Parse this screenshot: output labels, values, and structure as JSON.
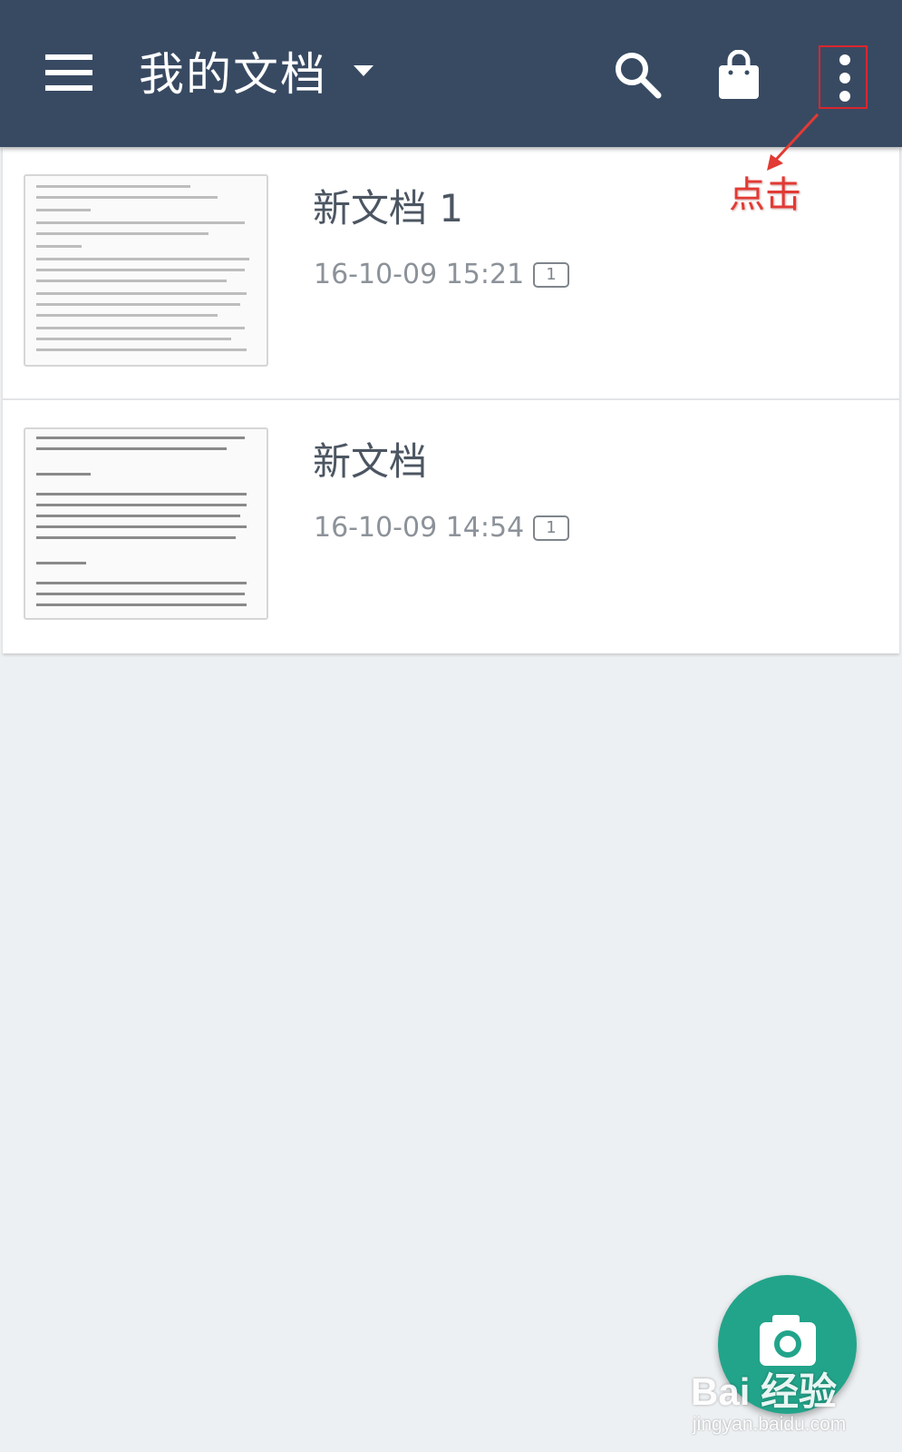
{
  "header": {
    "title": "我的文档",
    "background_color": "#384a62",
    "icons": [
      "menu-icon",
      "dropdown-caret-icon",
      "search-icon",
      "shopping-bag-icon",
      "more-vert-icon"
    ]
  },
  "documents": [
    {
      "name": "新文档 1",
      "timestamp": "16-10-09 15:21",
      "page_count": "1"
    },
    {
      "name": "新文档",
      "timestamp": "16-10-09 14:54",
      "page_count": "1"
    }
  ],
  "annotation": {
    "text": "点击",
    "color": "#e23a34"
  },
  "fab": {
    "icon": "camera-icon",
    "color": "#22a48a"
  },
  "watermark": {
    "logo": "Bai 经验",
    "url": "jingyan.baidu.com"
  }
}
